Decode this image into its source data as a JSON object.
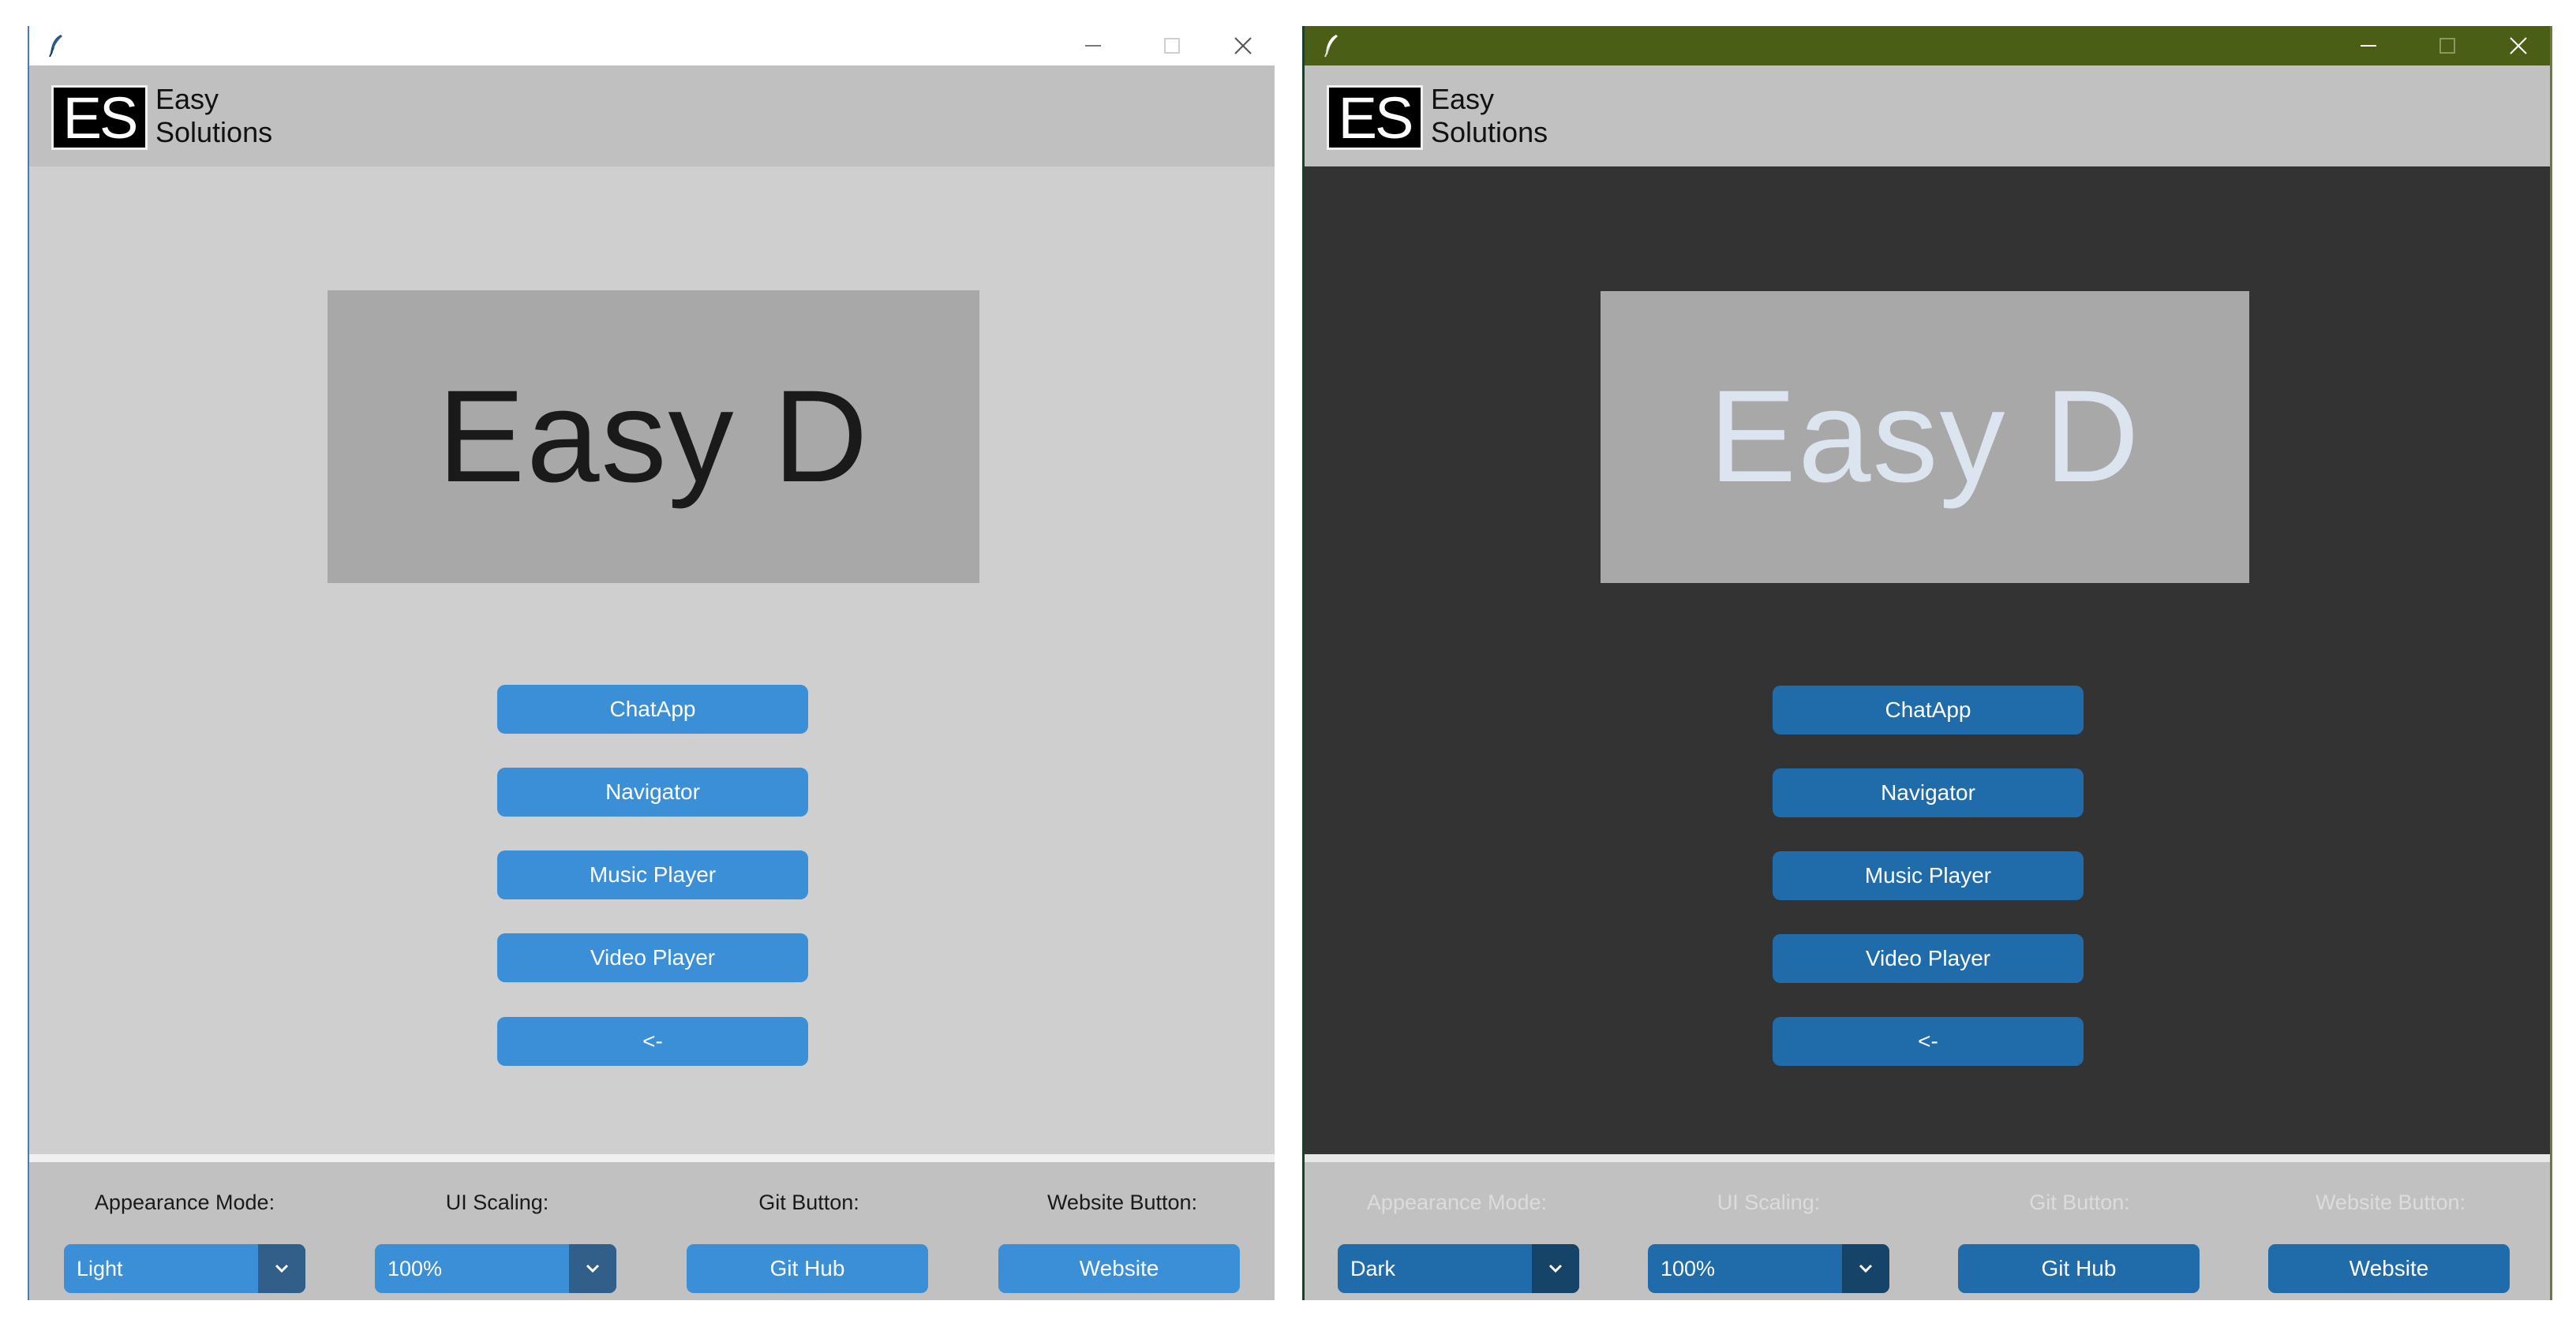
{
  "colors": {
    "light_accent": "#3a8fd6",
    "dark_accent": "#206ba9",
    "dark_titlebar": "#4b5e15",
    "light_background": "#cfcfcf",
    "dark_background": "#333333"
  },
  "icons": {
    "app": "feather-icon",
    "minimize": "minimize-icon",
    "maximize": "maximize-icon",
    "close": "close-icon",
    "dropdown": "chevron-down-icon"
  },
  "windows": [
    {
      "mode": "light",
      "logo": {
        "mark": "ES",
        "line1": "Easy",
        "line2": "Solutions"
      },
      "banner": "Easy D",
      "buttons": [
        "ChatApp",
        "Navigator",
        "Music Player",
        "Video Player",
        "<-"
      ],
      "footer": {
        "appearance_label": "Appearance Mode:",
        "appearance_value": "Light",
        "scaling_label": "UI Scaling:",
        "scaling_value": "100%",
        "git_label": "Git Button:",
        "git_button": "Git Hub",
        "website_label": "Website Button:",
        "website_button": "Website"
      }
    },
    {
      "mode": "dark",
      "logo": {
        "mark": "ES",
        "line1": "Easy",
        "line2": "Solutions"
      },
      "banner": "Easy D",
      "buttons": [
        "ChatApp",
        "Navigator",
        "Music Player",
        "Video Player",
        "<-"
      ],
      "footer": {
        "appearance_label": "Appearance Mode:",
        "appearance_value": "Dark",
        "scaling_label": "UI Scaling:",
        "scaling_value": "100%",
        "git_label": "Git Button:",
        "git_button": "Git Hub",
        "website_label": "Website Button:",
        "website_button": "Website"
      }
    }
  ]
}
